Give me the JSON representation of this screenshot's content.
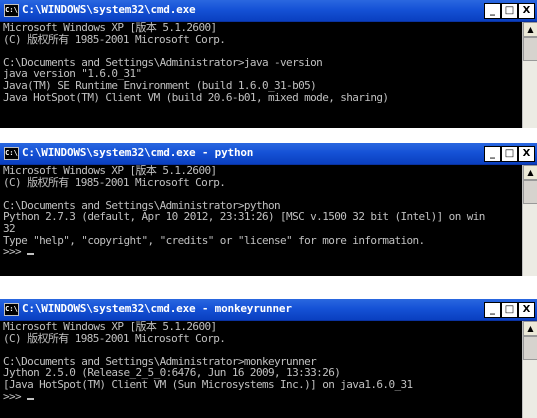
{
  "windows": [
    {
      "title": "C:\\WINDOWS\\system32\\cmd.exe",
      "icon_text": "C:\\",
      "lines": [
        "Microsoft Windows XP [版本 5.1.2600]",
        "(C) 版权所有 1985-2001 Microsoft Corp.",
        "",
        "C:\\Documents and Settings\\Administrator>java -version",
        "java version \"1.6.0_31\"",
        "Java(TM) SE Runtime Environment (build 1.6.0_31-b05)",
        "Java HotSpot(TM) Client VM (build 20.6-b01, mixed mode, sharing)"
      ]
    },
    {
      "title": "C:\\WINDOWS\\system32\\cmd.exe - python",
      "icon_text": "C:\\",
      "lines": [
        "Microsoft Windows XP [版本 5.1.2600]",
        "(C) 版权所有 1985-2001 Microsoft Corp.",
        "",
        "C:\\Documents and Settings\\Administrator>python",
        "Python 2.7.3 (default, Apr 10 2012, 23:31:26) [MSC v.1500 32 bit (Intel)] on win",
        "32",
        "Type \"help\", \"copyright\", \"credits\" or \"license\" for more information.",
        ">>> "
      ]
    },
    {
      "title": "C:\\WINDOWS\\system32\\cmd.exe - monkeyrunner",
      "icon_text": "C:\\",
      "lines": [
        "Microsoft Windows XP [版本 5.1.2600]",
        "(C) 版权所有 1985-2001 Microsoft Corp.",
        "",
        "C:\\Documents and Settings\\Administrator>monkeyrunner",
        "Jython 2.5.0 (Release_2_5_0:6476, Jun 16 2009, 13:33:26)",
        "[Java HotSpot(TM) Client VM (Sun Microsystems Inc.)] on java1.6.0_31",
        ">>> "
      ]
    }
  ],
  "buttons": {
    "minimize": "_",
    "maximize": "□",
    "close": "X"
  },
  "scrollbar": {
    "up_arrow": "▲"
  }
}
